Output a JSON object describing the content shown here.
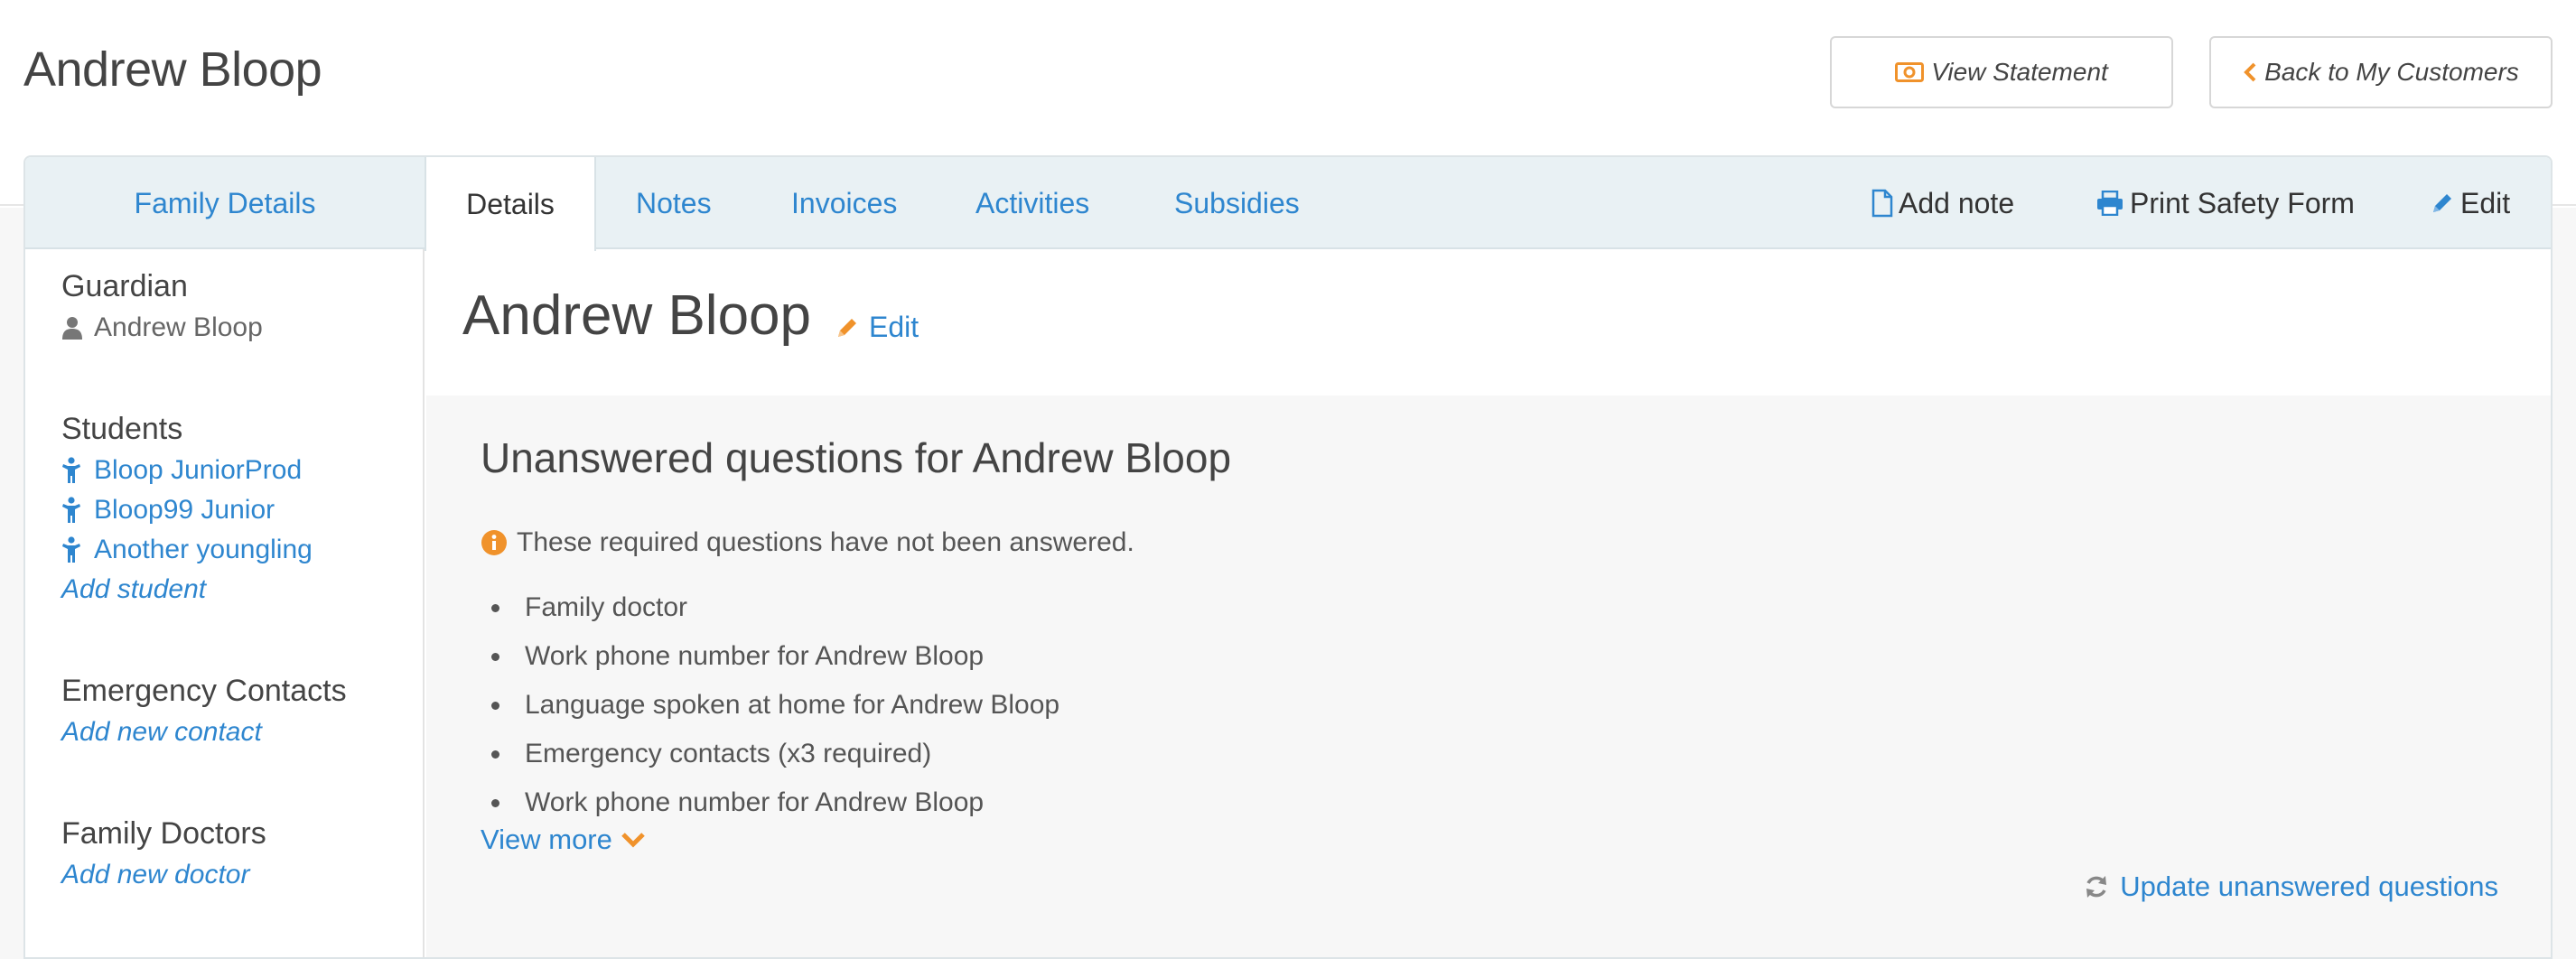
{
  "header": {
    "title": "Andrew Bloop",
    "view_statement": "View Statement",
    "back": "Back to My Customers"
  },
  "tabs": {
    "family_details": "Family Details",
    "details": "Details",
    "notes": "Notes",
    "invoices": "Invoices",
    "activities": "Activities",
    "subsidies": "Subsidies"
  },
  "actions": {
    "add_note": "Add note",
    "print_safety_form": "Print Safety Form",
    "edit": "Edit"
  },
  "sidebar": {
    "guardian_heading": "Guardian",
    "guardian_name": "Andrew Bloop",
    "students_heading": "Students",
    "students": [
      "Bloop JuniorProd",
      "Bloop99 Junior",
      "Another youngling"
    ],
    "add_student": "Add student",
    "emergency_heading": "Emergency Contacts",
    "add_contact": "Add new contact",
    "doctors_heading": "Family Doctors",
    "add_doctor": "Add new doctor"
  },
  "main": {
    "name": "Andrew Bloop",
    "edit": "Edit",
    "uq_title": "Unanswered questions for Andrew Bloop",
    "uq_note": "These required questions have not been answered.",
    "questions": [
      "Family doctor",
      "Work phone number for Andrew Bloop",
      "Language spoken at home for Andrew Bloop",
      "Emergency contacts (x3 required)",
      "Work phone number for Andrew Bloop"
    ],
    "view_more": "View more",
    "update": "Update unanswered questions"
  },
  "colors": {
    "link": "#2e86cf",
    "accent": "#f0922b",
    "tabbar": "#e9f1f4"
  },
  "icons": [
    "money-icon",
    "chevron-left-icon",
    "file-icon",
    "print-icon",
    "pencil-icon",
    "user-icon",
    "child-icon",
    "info-icon",
    "chevron-down-icon",
    "refresh-icon"
  ]
}
